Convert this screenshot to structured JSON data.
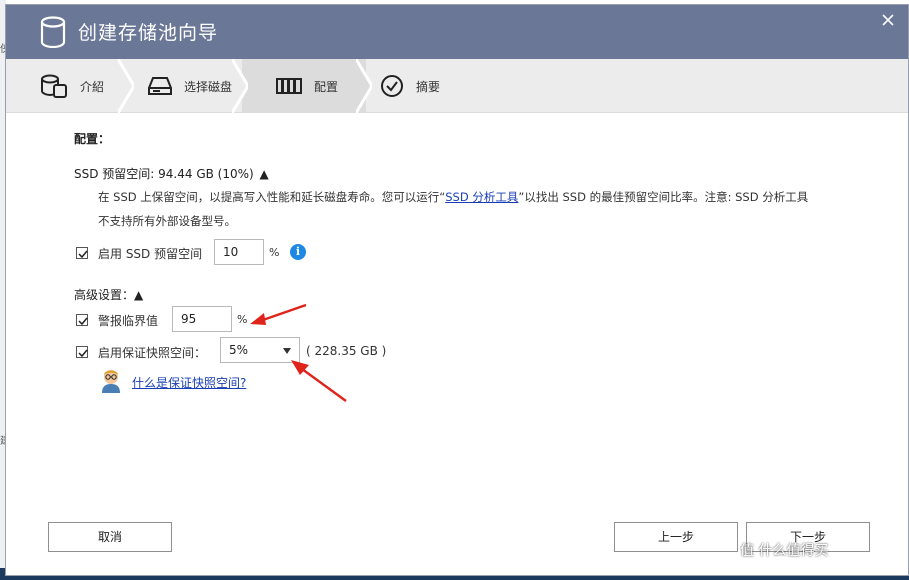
{
  "dialog": {
    "title": "创建存储池向导",
    "close_icon": "close-icon"
  },
  "steps": [
    {
      "label": "介紹",
      "icon": "database-icon"
    },
    {
      "label": "选择磁盘",
      "icon": "disk-icon"
    },
    {
      "label": "配置",
      "icon": "config-icon",
      "active": true
    },
    {
      "label": "摘要",
      "icon": "check-circle-icon"
    }
  ],
  "config": {
    "heading": "配置：",
    "ssd": {
      "title": "SSD 预留空间:  94.44 GB  (10%)",
      "toggle": "▲",
      "desc_line1_prefix": "在 SSD 上保留空间，以提高写入性能和延长磁盘寿命。您可以运行“",
      "desc_link": "SSD 分析工具",
      "desc_line1_suffix": "”以找出 SSD 的最佳预留空间比率。注意: SSD 分析工具",
      "desc_line2": "不支持所有外部设备型号。",
      "enable_label": "启用 SSD 预留空间",
      "value": "10",
      "unit": "%",
      "info_icon": "i"
    },
    "advanced": {
      "heading": "高级设置：",
      "toggle": "▲",
      "alert_label": "警报临界值",
      "alert_value": "95",
      "alert_unit": "%",
      "snapshot_label": "启用保证快照空间：",
      "snapshot_value": "5%",
      "snapshot_size": "( 228.35 GB )",
      "help_link": "什么是保证快照空间?"
    }
  },
  "buttons": {
    "cancel": "取消",
    "prev": "上一步",
    "next": "下一步"
  },
  "watermark": "值 什么值得买",
  "colors": {
    "titlebar": "#6a7797",
    "link": "#1a3fb4",
    "arrow": "#e0241b",
    "info": "#1e88e5"
  }
}
